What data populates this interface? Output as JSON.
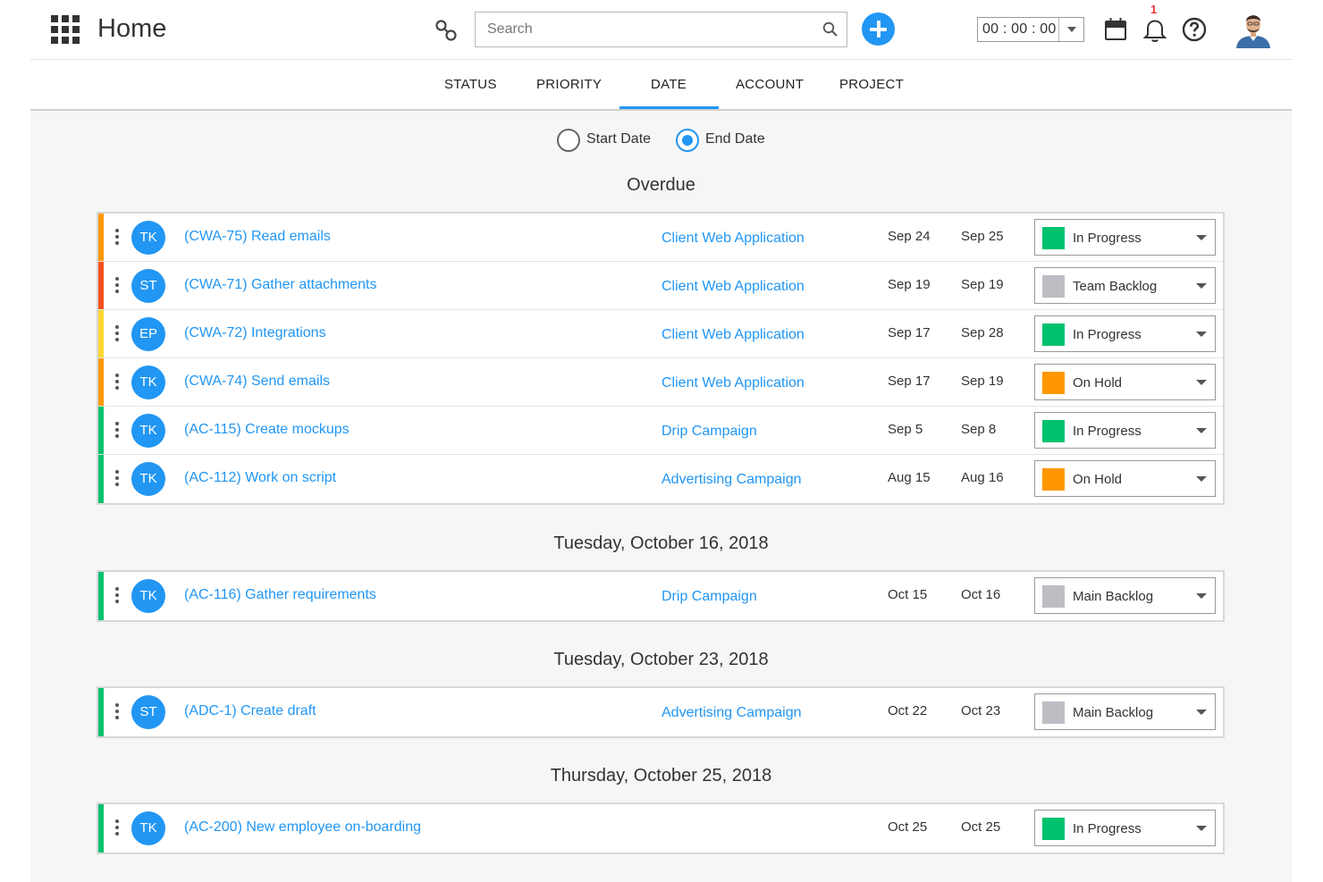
{
  "header": {
    "title": "Home",
    "search_placeholder": "Search",
    "timer": "00 : 00 : 00",
    "notification_count": "1"
  },
  "tabs": [
    "STATUS",
    "PRIORITY",
    "DATE",
    "ACCOUNT",
    "PROJECT"
  ],
  "active_tab": "DATE",
  "date_filter": {
    "start_label": "Start Date",
    "end_label": "End Date",
    "selected": "End Date"
  },
  "colors": {
    "accent": "#2196f3",
    "priority_orange": "#ff9800",
    "priority_red": "#f4511e",
    "priority_yellow": "#fdd835",
    "priority_green": "#00c16e",
    "status_in_progress": "#00c16e",
    "status_on_hold": "#ff9800",
    "status_backlog": "#bdbdc4"
  },
  "groups": [
    {
      "title": "Overdue",
      "tasks": [
        {
          "initials": "TK",
          "name": "(CWA-75) Read emails",
          "project": "Client Web Application",
          "start": "Sep 24",
          "end": "Sep 25",
          "status": "In Progress"
        },
        {
          "initials": "ST",
          "name": "(CWA-71) Gather attachments",
          "project": "Client Web Application",
          "start": "Sep 19",
          "end": "Sep 19",
          "status": "Team Backlog"
        },
        {
          "initials": "EP",
          "name": "(CWA-72) Integrations",
          "project": "Client Web Application",
          "start": "Sep 17",
          "end": "Sep 28",
          "status": "In Progress"
        },
        {
          "initials": "TK",
          "name": "(CWA-74) Send emails",
          "project": "Client Web Application",
          "start": "Sep 17",
          "end": "Sep 19",
          "status": "On Hold"
        },
        {
          "initials": "TK",
          "name": "(AC-115) Create mockups",
          "project": "Drip Campaign",
          "start": "Sep 5",
          "end": "Sep 8",
          "status": "In Progress"
        },
        {
          "initials": "TK",
          "name": "(AC-112) Work on script",
          "project": "Advertising Campaign",
          "start": "Aug 15",
          "end": "Aug 16",
          "status": "On Hold"
        }
      ]
    },
    {
      "title": "Tuesday, October 16, 2018",
      "tasks": [
        {
          "initials": "TK",
          "name": "(AC-116) Gather requirements",
          "project": "Drip Campaign",
          "start": "Oct 15",
          "end": "Oct 16",
          "status": "Main Backlog"
        }
      ]
    },
    {
      "title": "Tuesday, October 23, 2018",
      "tasks": [
        {
          "initials": "ST",
          "name": "(ADC-1) Create draft",
          "project": "Advertising Campaign",
          "start": "Oct 22",
          "end": "Oct 23",
          "status": "Main Backlog"
        }
      ]
    },
    {
      "title": "Thursday, October 25, 2018",
      "tasks": [
        {
          "initials": "TK",
          "name": "(AC-200) New employee on-boarding",
          "project": "",
          "start": "Oct 25",
          "end": "Oct 25",
          "status": "In Progress"
        }
      ]
    }
  ]
}
